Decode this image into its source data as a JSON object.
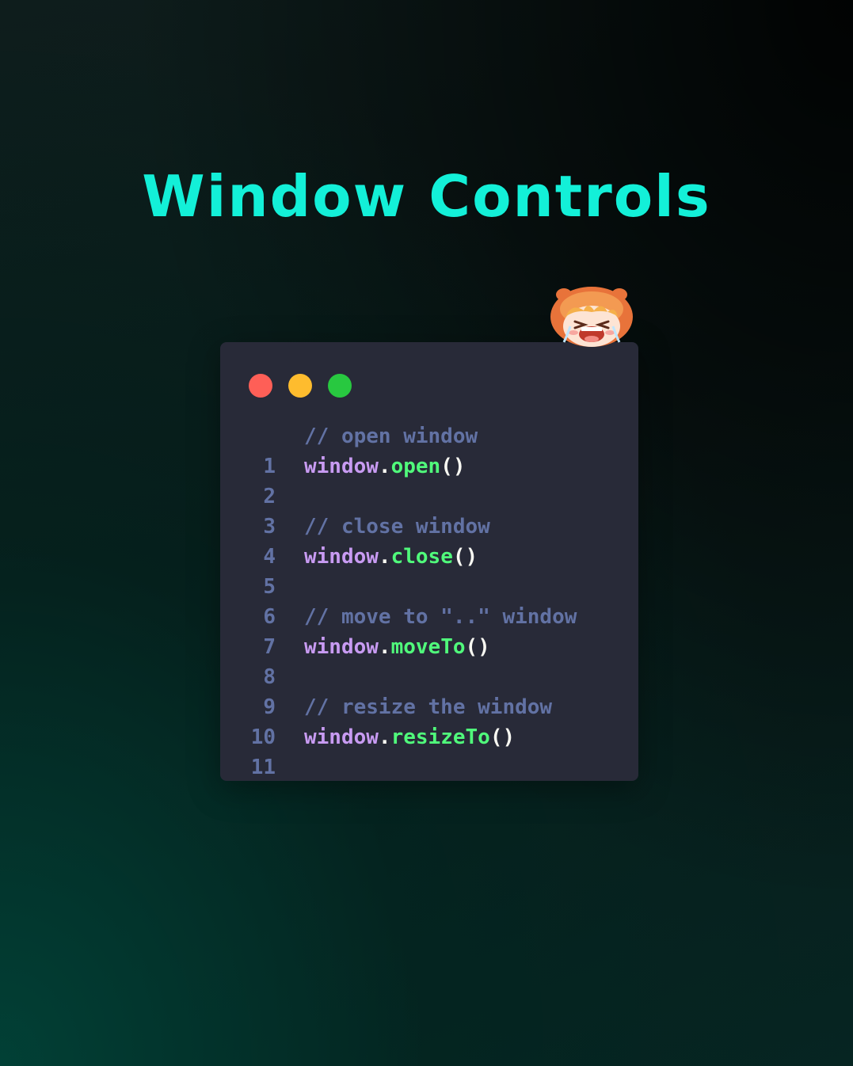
{
  "title": "Window Controls",
  "colors": {
    "title": "#13f0d8",
    "card_background": "#282a38",
    "window_dot_red": "#fe5f57",
    "window_dot_yellow": "#febc2e",
    "window_dot_green": "#28c840",
    "comment": "#6272a4",
    "object": "#c89bf2",
    "method": "#50fa7b",
    "punctuation": "#f8f8f2"
  },
  "mascot": "anime-girl-mascot",
  "code": {
    "lines": [
      {
        "number": "1",
        "comment": "// open window"
      },
      {
        "number": "2",
        "object": "window",
        "dot": ".",
        "method": "open",
        "parens": "()"
      },
      {
        "number": "3"
      },
      {
        "number": "4",
        "comment": "// close window"
      },
      {
        "number": "5",
        "object": "window",
        "dot": ".",
        "method": "close",
        "parens": "()"
      },
      {
        "number": "6"
      },
      {
        "number": "7",
        "comment": "// move to \"..\" window"
      },
      {
        "number": "8",
        "object": "window",
        "dot": ".",
        "method": "moveTo",
        "parens": "()"
      },
      {
        "number": "9"
      },
      {
        "number": "10",
        "comment": "// resize the window"
      },
      {
        "number": "11",
        "object": "window",
        "dot": ".",
        "method": "resizeTo",
        "parens": "()"
      }
    ]
  }
}
